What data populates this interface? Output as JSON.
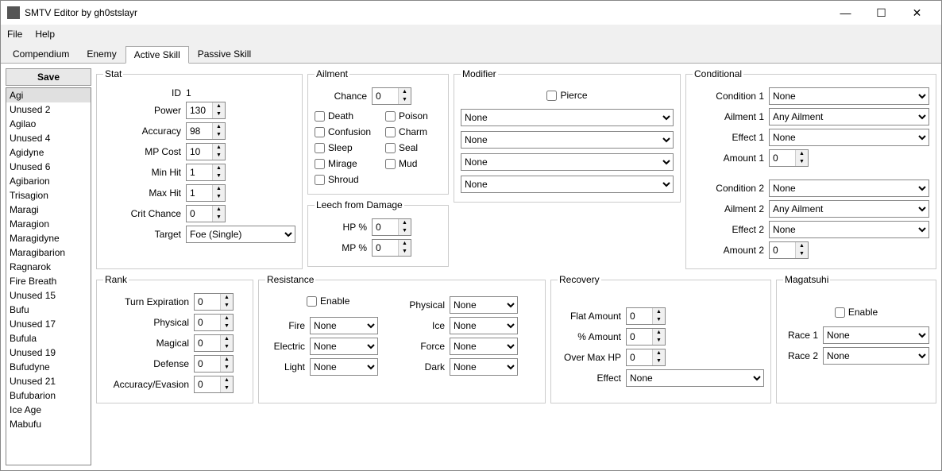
{
  "window": {
    "title": "SMTV Editor by gh0stslayr"
  },
  "menu": {
    "file": "File",
    "help": "Help"
  },
  "tabs": [
    "Compendium",
    "Enemy",
    "Active Skill",
    "Passive Skill"
  ],
  "active_tab": 2,
  "save_label": "Save",
  "skills": [
    "Agi",
    "Unused 2",
    "Agilao",
    "Unused 4",
    "Agidyne",
    "Unused 6",
    "Agibarion",
    "Trisagion",
    "Maragi",
    "Maragion",
    "Maragidyne",
    "Maragibarion",
    "Ragnarok",
    "Fire Breath",
    "Unused 15",
    "Bufu",
    "Unused 17",
    "Bufula",
    "Unused 19",
    "Bufudyne",
    "Unused 21",
    "Bufubarion",
    "Ice Age",
    "Mabufu"
  ],
  "selected_skill": 0,
  "stat": {
    "legend": "Stat",
    "id_label": "ID",
    "id": "1",
    "power_label": "Power",
    "power": "130",
    "accuracy_label": "Accuracy",
    "accuracy": "98",
    "mpcost_label": "MP Cost",
    "mpcost": "10",
    "minhit_label": "Min Hit",
    "minhit": "1",
    "maxhit_label": "Max Hit",
    "maxhit": "1",
    "crit_label": "Crit Chance",
    "crit": "0",
    "target_label": "Target",
    "target": "Foe (Single)"
  },
  "ailment": {
    "legend": "Ailment",
    "chance_label": "Chance",
    "chance": "0",
    "death": "Death",
    "poison": "Poison",
    "confusion": "Confusion",
    "charm": "Charm",
    "sleep": "Sleep",
    "seal": "Seal",
    "mirage": "Mirage",
    "mud": "Mud",
    "shroud": "Shroud"
  },
  "leech": {
    "legend": "Leech from Damage",
    "hp_label": "HP %",
    "hp": "0",
    "mp_label": "MP %",
    "mp": "0"
  },
  "modifier": {
    "legend": "Modifier",
    "pierce": "Pierce",
    "v1": "None",
    "v2": "None",
    "v3": "None",
    "v4": "None"
  },
  "conditional": {
    "legend": "Conditional",
    "c1": "Condition 1",
    "c1v": "None",
    "a1": "Ailment 1",
    "a1v": "Any Ailment",
    "e1": "Effect 1",
    "e1v": "None",
    "am1": "Amount 1",
    "am1v": "0",
    "c2": "Condition 2",
    "c2v": "None",
    "a2": "Ailment 2",
    "a2v": "Any Ailment",
    "e2": "Effect 2",
    "e2v": "None",
    "am2": "Amount 2",
    "am2v": "0"
  },
  "rank": {
    "legend": "Rank",
    "turn": "Turn Expiration",
    "turnv": "0",
    "phys": "Physical",
    "physv": "0",
    "mag": "Magical",
    "magv": "0",
    "def": "Defense",
    "defv": "0",
    "acc": "Accuracy/Evasion",
    "accv": "0"
  },
  "resistance": {
    "legend": "Resistance",
    "enable": "Enable",
    "fire": "Fire",
    "firev": "None",
    "elec": "Electric",
    "elecv": "None",
    "light": "Light",
    "lightv": "None",
    "physical": "Physical",
    "physicalv": "None",
    "ice": "Ice",
    "icev": "None",
    "force": "Force",
    "forcev": "None",
    "dark": "Dark",
    "darkv": "None"
  },
  "recovery": {
    "legend": "Recovery",
    "flat": "Flat Amount",
    "flatv": "0",
    "pct": "% Amount",
    "pctv": "0",
    "over": "Over Max HP",
    "overv": "0",
    "eff": "Effect",
    "effv": "None"
  },
  "magatsuhi": {
    "legend": "Magatsuhi",
    "enable": "Enable",
    "r1": "Race 1",
    "r1v": "None",
    "r2": "Race 2",
    "r2v": "None"
  }
}
